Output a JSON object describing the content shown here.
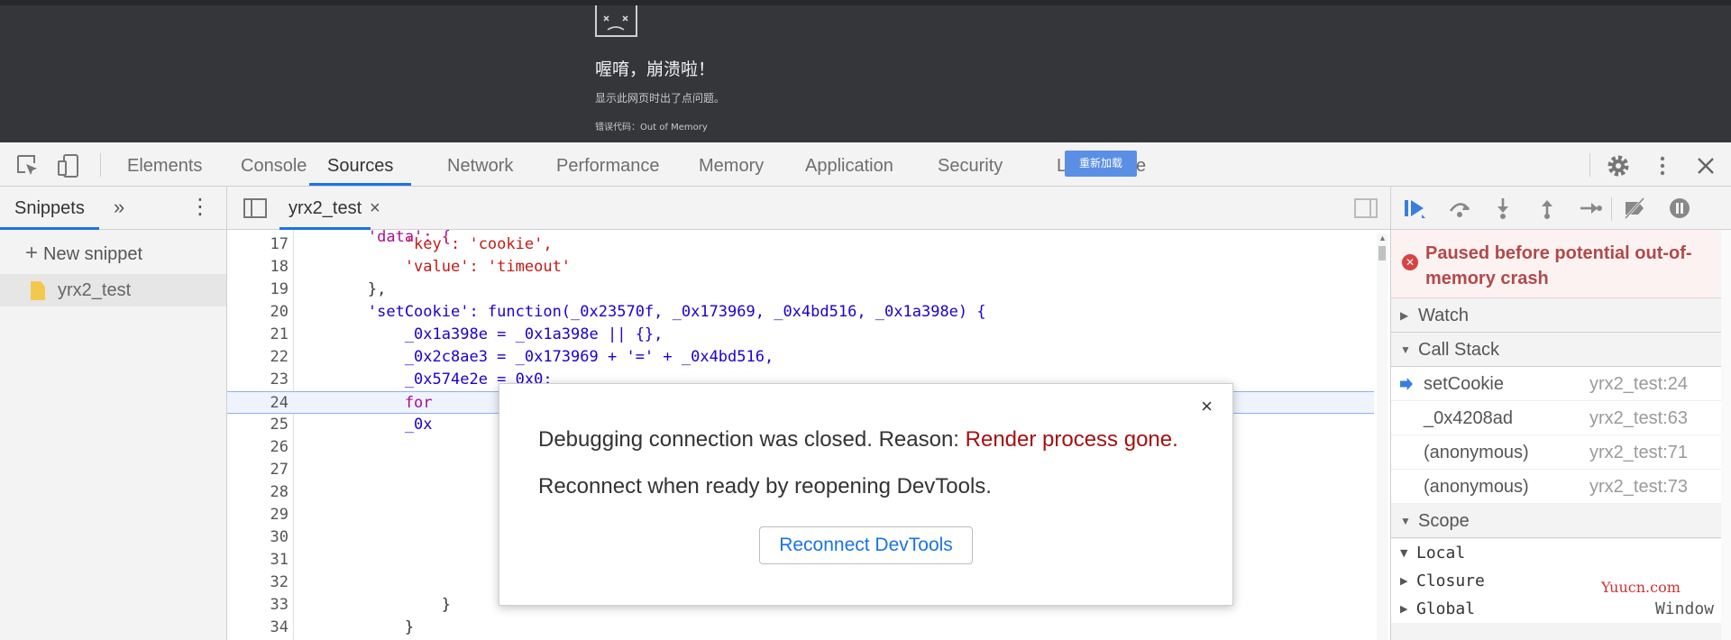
{
  "crash_page": {
    "title": "喔唷，崩溃啦！",
    "subtitle": "显示此网页时出了点问题。",
    "error_code": "错误代码：Out of Memory",
    "reload_button": "重新加载"
  },
  "devtools": {
    "tabs": [
      {
        "label": "Elements"
      },
      {
        "label": "Console"
      },
      {
        "label": "Sources",
        "active": true
      },
      {
        "label": "Network"
      },
      {
        "label": "Performance"
      },
      {
        "label": "Memory"
      },
      {
        "label": "Application"
      },
      {
        "label": "Security"
      },
      {
        "label": "L",
        "tail": "e"
      }
    ]
  },
  "sidebar": {
    "tab": "Snippets",
    "new_snippet": "New snippet",
    "items": [
      {
        "label": "yrx2_test"
      }
    ]
  },
  "editor": {
    "tab": "yrx2_test",
    "close": "×",
    "lines": [
      {
        "n": "17",
        "src": "            'key': 'cookie',"
      },
      {
        "n": "18",
        "src": "            'value': 'timeout'"
      },
      {
        "n": "19",
        "src": "        },"
      },
      {
        "n": "20",
        "src": "        'setCookie': function(_0x23570f, _0x173969, _0x4bd516, _0x1a398e) {"
      },
      {
        "n": "21",
        "src": "            _0x1a398e = _0x1a398e || {},"
      },
      {
        "n": "22",
        "src": "            _0x2c8ae3 = _0x173969 + '=' + _0x4bd516,"
      },
      {
        "n": "23",
        "src": "            _0x574e2e = 0x0;"
      },
      {
        "n": "24",
        "src": "            for",
        "highlight": true
      },
      {
        "n": "25",
        "src": "            _0x"
      },
      {
        "n": "26",
        "src": ""
      },
      {
        "n": "27",
        "src": ""
      },
      {
        "n": "28",
        "src": ""
      },
      {
        "n": "29",
        "src": ""
      },
      {
        "n": "30",
        "src": ""
      },
      {
        "n": "31",
        "src": ""
      },
      {
        "n": "32",
        "src": ""
      },
      {
        "n": "33",
        "src": "                }"
      },
      {
        "n": "34",
        "src": "            }"
      }
    ]
  },
  "debugger": {
    "paused_message": "Paused before potential out-of-memory crash",
    "sections": {
      "watch": "Watch",
      "call_stack": "Call Stack",
      "scope": "Scope"
    },
    "call_stack": [
      {
        "name": "setCookie",
        "loc": "yrx2_test:24",
        "current": true
      },
      {
        "name": "_0x4208ad",
        "loc": "yrx2_test:63"
      },
      {
        "name": "(anonymous)",
        "loc": "yrx2_test:71"
      },
      {
        "name": "(anonymous)",
        "loc": "yrx2_test:73"
      }
    ],
    "scope": [
      {
        "name": "Local",
        "value": "",
        "expanded": true
      },
      {
        "name": "Closure",
        "value": ""
      },
      {
        "name": "Global",
        "value": "Window"
      }
    ]
  },
  "modal": {
    "line1_prefix": "Debugging connection was closed. Reason: ",
    "line1_reason": "Render process gone.",
    "line2": "Reconnect when ready by reopening DevTools.",
    "button": "Reconnect DevTools",
    "close": "×"
  },
  "watermark": "Yuucn.com"
}
